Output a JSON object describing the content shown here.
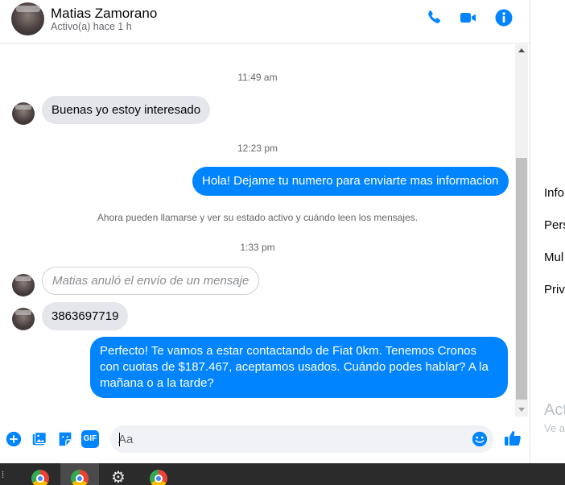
{
  "header": {
    "name": "Matias Zamorano",
    "status": "Activo(a) hace 1 h",
    "actions": [
      "phone-icon",
      "video-icon",
      "info-icon"
    ]
  },
  "messages": {
    "ts1": "11:49 am",
    "msg1": "Buenas yo estoy interesado",
    "ts2": "12:23 pm",
    "msg2": "Hola! Dejame tu numero para enviarte mas informacion",
    "notice": "Ahora pueden llamarse y ver su estado activo y cuándo leen los mensajes.",
    "ts3": "1:33 pm",
    "unsent": "Matias anuló el envío de un mensaje",
    "msg3": "3863697719",
    "msg4": "Perfecto! Te vamos a estar contactando de Fiat 0km. Tenemos Cronos con cuotas de $187.467, aceptamos usados. Cuándo podes hablar? A la mañana o a la tarde?"
  },
  "composer": {
    "placeholder": "Aa",
    "actions": [
      "add-icon",
      "photo-icon",
      "sticker-icon",
      "gif-icon",
      "emoji-icon",
      "like-icon"
    ],
    "gif_label": "GIF"
  },
  "side_panel": {
    "items": [
      "Info",
      "Pers",
      "Mul",
      "Priv"
    ],
    "activate_title": "Act",
    "activate_sub": "Ve a"
  },
  "colors": {
    "accent": "#0084ff",
    "bubble_in": "#e4e6eb",
    "taskbar": "#2b2b2b"
  },
  "taskbar": {
    "items": [
      "chrome-icon",
      "chrome-icon",
      "settings-icon",
      "chrome-icon"
    ]
  }
}
